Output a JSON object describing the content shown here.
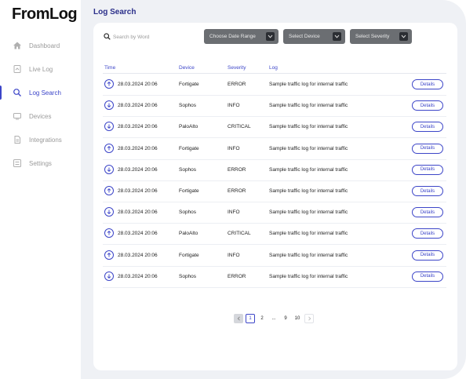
{
  "app": {
    "logo": "FromLog"
  },
  "sidebar": {
    "items": [
      {
        "label": "Dashboard",
        "icon": "home-icon",
        "active": false
      },
      {
        "label": "Live Log",
        "icon": "live-log-icon",
        "active": false
      },
      {
        "label": "Log Search",
        "icon": "search-icon",
        "active": true
      },
      {
        "label": "Devices",
        "icon": "devices-icon",
        "active": false
      },
      {
        "label": "Integrations",
        "icon": "integrations-icon",
        "active": false
      },
      {
        "label": "Settings",
        "icon": "settings-icon",
        "active": false
      }
    ]
  },
  "page": {
    "title": "Log Search"
  },
  "search": {
    "placeholder": "Search by Word"
  },
  "filters": {
    "date_range": "Choose Date Range",
    "device": "Select Device",
    "severity": "Select Severity"
  },
  "table": {
    "headers": [
      "Time",
      "Device",
      "Severity",
      "Log"
    ],
    "details_label": "Details",
    "rows": [
      {
        "dir": "up",
        "time": "28.03.2024 20:06",
        "device": "Fortigate",
        "severity": "ERROR",
        "log": "Sample traffic log for internal traffic"
      },
      {
        "dir": "down",
        "time": "28.03.2024 20:06",
        "device": "Sophos",
        "severity": "INFO",
        "log": "Sample traffic log for internal traffic"
      },
      {
        "dir": "down",
        "time": "28.03.2024 20:06",
        "device": "PaloAlto",
        "severity": "CRITICAL",
        "log": "Sample traffic log for internal traffic"
      },
      {
        "dir": "up",
        "time": "28.03.2024 20:06",
        "device": "Fortigate",
        "severity": "INFO",
        "log": "Sample traffic log for internal traffic"
      },
      {
        "dir": "down",
        "time": "28.03.2024 20:06",
        "device": "Sophos",
        "severity": "ERROR",
        "log": "Sample traffic log for internal traffic"
      },
      {
        "dir": "up",
        "time": "28.03.2024 20:06",
        "device": "Fortigate",
        "severity": "ERROR",
        "log": "Sample traffic log for internal traffic"
      },
      {
        "dir": "down",
        "time": "28.03.2024 20:06",
        "device": "Sophos",
        "severity": "INFO",
        "log": "Sample traffic log for internal traffic"
      },
      {
        "dir": "up",
        "time": "28.03.2024 20:06",
        "device": "PaloAlto",
        "severity": "CRITICAL",
        "log": "Sample traffic log for internal traffic"
      },
      {
        "dir": "up",
        "time": "28.03.2024 20:06",
        "device": "Fortigate",
        "severity": "INFO",
        "log": "Sample traffic log for internal traffic"
      },
      {
        "dir": "down",
        "time": "28.03.2024 20:06",
        "device": "Sophos",
        "severity": "ERROR",
        "log": "Sample traffic log for internal traffic"
      }
    ]
  },
  "pagination": {
    "pages": [
      "1",
      "2",
      "...",
      "9",
      "10"
    ],
    "current": "1",
    "prev_icon": "chevron-left-icon",
    "next_icon": "chevron-right-icon"
  },
  "colors": {
    "accent": "#3c45c8",
    "title": "#2b2f8a",
    "dropdown": "#6b6e72",
    "background": "#eff1f5"
  }
}
